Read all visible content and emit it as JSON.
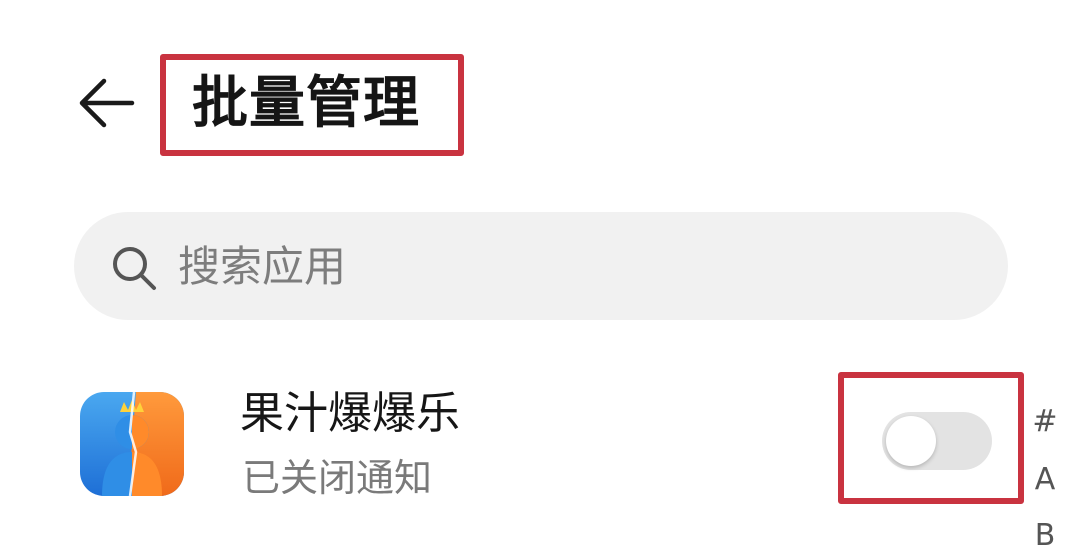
{
  "header": {
    "title": "批量管理",
    "back_icon": "back-arrow-icon"
  },
  "search": {
    "placeholder": "搜索应用",
    "value": "",
    "icon": "search-icon"
  },
  "apps": [
    {
      "name": "果汁爆爆乐",
      "status": "已关闭通知",
      "notifications_enabled": false
    }
  ],
  "index_bar": [
    "#",
    "A",
    "B"
  ],
  "colors": {
    "highlight": "#c93340",
    "search_bg": "#f1f1f1",
    "toggle_off": "#e3e3e3",
    "title_text": "#151515",
    "secondary_text": "#7a7a7a"
  }
}
